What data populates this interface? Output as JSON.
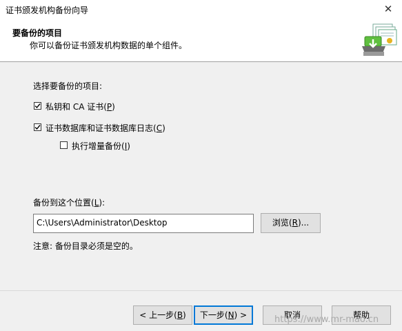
{
  "window": {
    "title": "证书颁发机构备份向导",
    "close_glyph": "✕"
  },
  "header": {
    "title": "要备份的项目",
    "subtitle": "你可以备份证书颁发机构数据的单个组件。",
    "icon": "certificate-backup-icon"
  },
  "items": {
    "prompt": "选择要备份的项目:",
    "private_key": {
      "label_prefix": "私钥和 CA 证书(",
      "accel": "P",
      "label_suffix": ")",
      "checked": true
    },
    "database": {
      "label_prefix": "证书数据库和证书数据库日志(",
      "accel": "C",
      "label_suffix": ")",
      "checked": true
    },
    "incremental": {
      "label_prefix": "执行增量备份(",
      "accel": "I",
      "label_suffix": ")",
      "checked": false
    }
  },
  "location": {
    "label_prefix": "备份到这个位置(",
    "accel": "L",
    "label_suffix": "):",
    "value": "C:\\Users\\Administrator\\Desktop",
    "browse_prefix": "浏览(",
    "browse_accel": "R",
    "browse_suffix": ")..."
  },
  "note": "注意: 备份目录必须是空的。",
  "footer": {
    "back_prefix": "< 上一步(",
    "back_accel": "B",
    "back_suffix": ")",
    "next_prefix": "下一步(",
    "next_accel": "N",
    "next_suffix": ") >",
    "cancel": "取消",
    "help": "帮助"
  },
  "watermark": "https://www.mr-mao.cn"
}
